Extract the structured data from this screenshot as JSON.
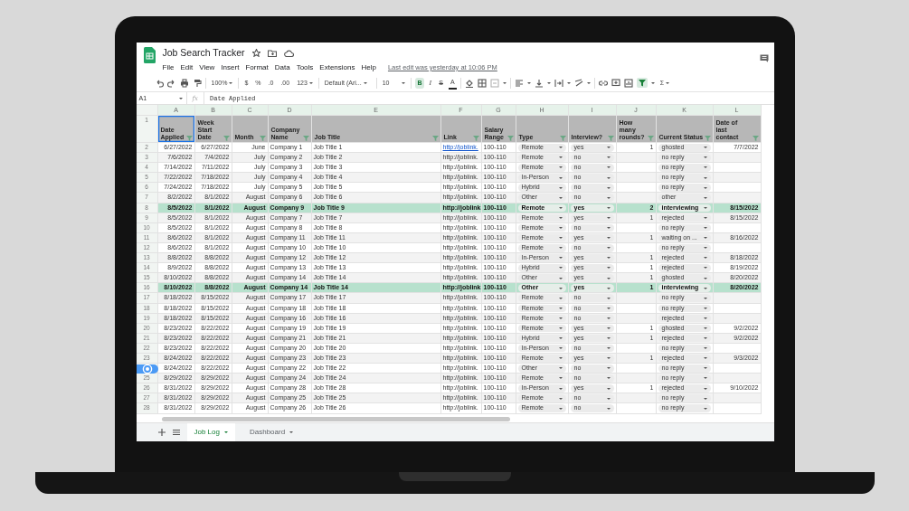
{
  "app": {
    "title": "Job Search Tracker",
    "menu": [
      "File",
      "Edit",
      "View",
      "Insert",
      "Format",
      "Data",
      "Tools",
      "Extensions",
      "Help"
    ],
    "last_edit": "Last edit was yesterday at 10:06 PM"
  },
  "toolbar": {
    "zoom": "100%",
    "currency": "$",
    "percent": "%",
    "decrease_decimals": ".0",
    "increase_decimals": ".00",
    "number_format": "123",
    "font": "Default (Ari...",
    "font_size": "10",
    "bold": {
      "label": "B",
      "on": true
    },
    "italic": "I",
    "strikethrough": "S",
    "text_color": "A",
    "filter_on": true,
    "functions": "Σ"
  },
  "formula_bar": {
    "cell": "A1",
    "fx": "fx",
    "value": "Date Applied"
  },
  "grid": {
    "column_letters": [
      "A",
      "B",
      "C",
      "D",
      "E",
      "F",
      "G",
      "H",
      "I",
      "J",
      "K",
      "L"
    ],
    "header_row_number": "1",
    "columns": [
      {
        "header": "Date\nApplied",
        "kind": "right",
        "selected": true
      },
      {
        "header": "Week\nStart\nDate",
        "kind": "right",
        "selected": false
      },
      {
        "header": "Month",
        "kind": "right",
        "selected": false
      },
      {
        "header": "Company\nName",
        "kind": "left",
        "selected": false
      },
      {
        "header": "Job Title",
        "kind": "left",
        "selected": false
      },
      {
        "header": "Link",
        "kind": "link",
        "selected": false
      },
      {
        "header": "Salary\nRange",
        "kind": "left",
        "selected": false
      },
      {
        "header": "Type",
        "kind": "chip",
        "selected": false
      },
      {
        "header": "Interview?",
        "kind": "chip",
        "selected": false
      },
      {
        "header": "How\nmany\nrounds?",
        "kind": "right",
        "selected": false
      },
      {
        "header": "Current Status",
        "kind": "chip",
        "selected": false
      },
      {
        "header": "Date of\nlast\ncontact",
        "kind": "right",
        "selected": false
      }
    ],
    "rows": [
      {
        "num": "2",
        "highlighted": false,
        "hyperlink": true,
        "cells": [
          "6/27/2022",
          "6/27/2022",
          "June",
          "Company 1",
          "Job Title 1",
          "http://joblink.",
          "100-110",
          "Remote",
          "yes",
          "1",
          "ghosted",
          "7/7/2022"
        ]
      },
      {
        "num": "3",
        "highlighted": false,
        "hyperlink": false,
        "cells": [
          "7/6/2022",
          "7/4/2022",
          "July",
          "Company 2",
          "Job Title 2",
          "http://joblink.",
          "100-110",
          "Remote",
          "no",
          null,
          "no reply",
          null
        ]
      },
      {
        "num": "4",
        "highlighted": false,
        "hyperlink": false,
        "cells": [
          "7/14/2022",
          "7/11/2022",
          "July",
          "Company 3",
          "Job Title 3",
          "http://joblink.",
          "100-110",
          "Remote",
          "no",
          null,
          "no reply",
          null
        ]
      },
      {
        "num": "5",
        "highlighted": false,
        "hyperlink": false,
        "cells": [
          "7/22/2022",
          "7/18/2022",
          "July",
          "Company 4",
          "Job Title 4",
          "http://joblink.",
          "100-110",
          "In-Person",
          "no",
          null,
          "no reply",
          null
        ]
      },
      {
        "num": "6",
        "highlighted": false,
        "hyperlink": false,
        "cells": [
          "7/24/2022",
          "7/18/2022",
          "July",
          "Company 5",
          "Job Title 5",
          "http://joblink.",
          "100-110",
          "Hybrid",
          "no",
          null,
          "no reply",
          null
        ]
      },
      {
        "num": "7",
        "highlighted": false,
        "hyperlink": false,
        "cells": [
          "8/2/2022",
          "8/1/2022",
          "August",
          "Company 6",
          "Job Title 6",
          "http://joblink.",
          "100-110",
          "Other",
          "no",
          null,
          "other",
          null
        ]
      },
      {
        "num": "8",
        "highlighted": true,
        "hyperlink": false,
        "cells": [
          "8/5/2022",
          "8/1/2022",
          "August",
          "Company 9",
          "Job Title 9",
          "http://joblink",
          "100-110",
          "Remote",
          "yes",
          "2",
          "interviewing",
          "8/15/2022"
        ]
      },
      {
        "num": "9",
        "highlighted": false,
        "hyperlink": false,
        "cells": [
          "8/5/2022",
          "8/1/2022",
          "August",
          "Company 7",
          "Job Title 7",
          "http://joblink.",
          "100-110",
          "Remote",
          "yes",
          "1",
          "rejected",
          "8/15/2022"
        ]
      },
      {
        "num": "10",
        "highlighted": false,
        "hyperlink": false,
        "cells": [
          "8/5/2022",
          "8/1/2022",
          "August",
          "Company 8",
          "Job Title 8",
          "http://joblink.",
          "100-110",
          "Remote",
          "no",
          null,
          "no reply",
          null
        ]
      },
      {
        "num": "11",
        "highlighted": false,
        "hyperlink": false,
        "cells": [
          "8/6/2022",
          "8/1/2022",
          "August",
          "Company 11",
          "Job Title 11",
          "http://joblink.",
          "100-110",
          "Remote",
          "yes",
          "1",
          "waiting on ...",
          "8/16/2022"
        ]
      },
      {
        "num": "12",
        "highlighted": false,
        "hyperlink": false,
        "cells": [
          "8/6/2022",
          "8/1/2022",
          "August",
          "Company 10",
          "Job Title 10",
          "http://joblink.",
          "100-110",
          "Remote",
          "no",
          null,
          "no reply",
          null
        ]
      },
      {
        "num": "13",
        "highlighted": false,
        "hyperlink": false,
        "cells": [
          "8/8/2022",
          "8/8/2022",
          "August",
          "Company 12",
          "Job Title 12",
          "http://joblink.",
          "100-110",
          "In-Person",
          "yes",
          "1",
          "rejected",
          "8/18/2022"
        ]
      },
      {
        "num": "14",
        "highlighted": false,
        "hyperlink": false,
        "cells": [
          "8/9/2022",
          "8/8/2022",
          "August",
          "Company 13",
          "Job Title 13",
          "http://joblink.",
          "100-110",
          "Hybrid",
          "yes",
          "1",
          "rejected",
          "8/19/2022"
        ]
      },
      {
        "num": "15",
        "highlighted": false,
        "hyperlink": false,
        "cells": [
          "8/10/2022",
          "8/8/2022",
          "August",
          "Company 14",
          "Job Title 14",
          "http://joblink.",
          "100-110",
          "Other",
          "yes",
          "1",
          "ghosted",
          "8/20/2022"
        ]
      },
      {
        "num": "16",
        "highlighted": true,
        "hyperlink": false,
        "cells": [
          "8/10/2022",
          "8/8/2022",
          "August",
          "Company 14",
          "Job Title 14",
          "http://joblink",
          "100-110",
          "Other",
          "yes",
          "1",
          "interviewing",
          "8/20/2022"
        ]
      },
      {
        "num": "17",
        "highlighted": false,
        "hyperlink": false,
        "cells": [
          "8/18/2022",
          "8/15/2022",
          "August",
          "Company 17",
          "Job Title 17",
          "http://joblink.",
          "100-110",
          "Remote",
          "no",
          null,
          "no reply",
          null
        ]
      },
      {
        "num": "18",
        "highlighted": false,
        "hyperlink": false,
        "cells": [
          "8/18/2022",
          "8/15/2022",
          "August",
          "Company 18",
          "Job Title 18",
          "http://joblink.",
          "100-110",
          "Remote",
          "no",
          null,
          "no reply",
          null
        ]
      },
      {
        "num": "19",
        "highlighted": false,
        "hyperlink": false,
        "cells": [
          "8/18/2022",
          "8/15/2022",
          "August",
          "Company 16",
          "Job Title 16",
          "http://joblink.",
          "100-110",
          "Remote",
          "no",
          null,
          "rejected",
          null
        ]
      },
      {
        "num": "20",
        "highlighted": false,
        "hyperlink": false,
        "cells": [
          "8/23/2022",
          "8/22/2022",
          "August",
          "Company 19",
          "Job Title 19",
          "http://joblink.",
          "100-110",
          "Remote",
          "yes",
          "1",
          "ghosted",
          "9/2/2022"
        ]
      },
      {
        "num": "21",
        "highlighted": false,
        "hyperlink": false,
        "cells": [
          "8/23/2022",
          "8/22/2022",
          "August",
          "Company 21",
          "Job Title 21",
          "http://joblink.",
          "100-110",
          "Hybrid",
          "yes",
          "1",
          "rejected",
          "9/2/2022"
        ]
      },
      {
        "num": "22",
        "highlighted": false,
        "hyperlink": false,
        "cells": [
          "8/23/2022",
          "8/22/2022",
          "August",
          "Company 20",
          "Job Title 20",
          "http://joblink.",
          "100-110",
          "In-Person",
          "no",
          null,
          "no reply",
          null
        ]
      },
      {
        "num": "23",
        "highlighted": false,
        "hyperlink": false,
        "cells": [
          "8/24/2022",
          "8/22/2022",
          "August",
          "Company 23",
          "Job Title 23",
          "http://joblink.",
          "100-110",
          "Remote",
          "yes",
          "1",
          "rejected",
          "9/3/2022"
        ]
      },
      {
        "highlighted": false,
        "hyperlink": false,
        "cells": [
          "8/24/2022",
          "8/22/2022",
          "August",
          "Company 22",
          "Job Title 22",
          "http://joblink.",
          "100-110",
          "Other",
          "no",
          null,
          "no reply",
          null
        ]
      },
      {
        "num": "25",
        "highlighted": false,
        "hyperlink": false,
        "cells": [
          "8/29/2022",
          "8/29/2022",
          "August",
          "Company 24",
          "Job Title 24",
          "http://joblink.",
          "100-110",
          "Remote",
          "no",
          null,
          "no reply",
          null
        ]
      },
      {
        "num": "26",
        "highlighted": false,
        "hyperlink": false,
        "cells": [
          "8/31/2022",
          "8/29/2022",
          "August",
          "Company 28",
          "Job Title 28",
          "http://joblink.",
          "100-110",
          "In-Person",
          "yes",
          "1",
          "rejected",
          "9/10/2022"
        ]
      },
      {
        "num": "27",
        "highlighted": false,
        "hyperlink": false,
        "cells": [
          "8/31/2022",
          "8/29/2022",
          "August",
          "Company 25",
          "Job Title 25",
          "http://joblink.",
          "100-110",
          "Remote",
          "no",
          null,
          "no reply",
          null
        ]
      },
      {
        "num": "28",
        "highlighted": false,
        "hyperlink": false,
        "cells": [
          "8/31/2022",
          "8/29/2022",
          "August",
          "Company 26",
          "Job Title 26",
          "http://joblink.",
          "100-110",
          "Remote",
          "no",
          null,
          "no reply",
          null
        ]
      }
    ]
  },
  "sheet_tabs": [
    {
      "label": "Job Log",
      "selected": true
    },
    {
      "label": "Dashboard",
      "selected": false
    }
  ]
}
